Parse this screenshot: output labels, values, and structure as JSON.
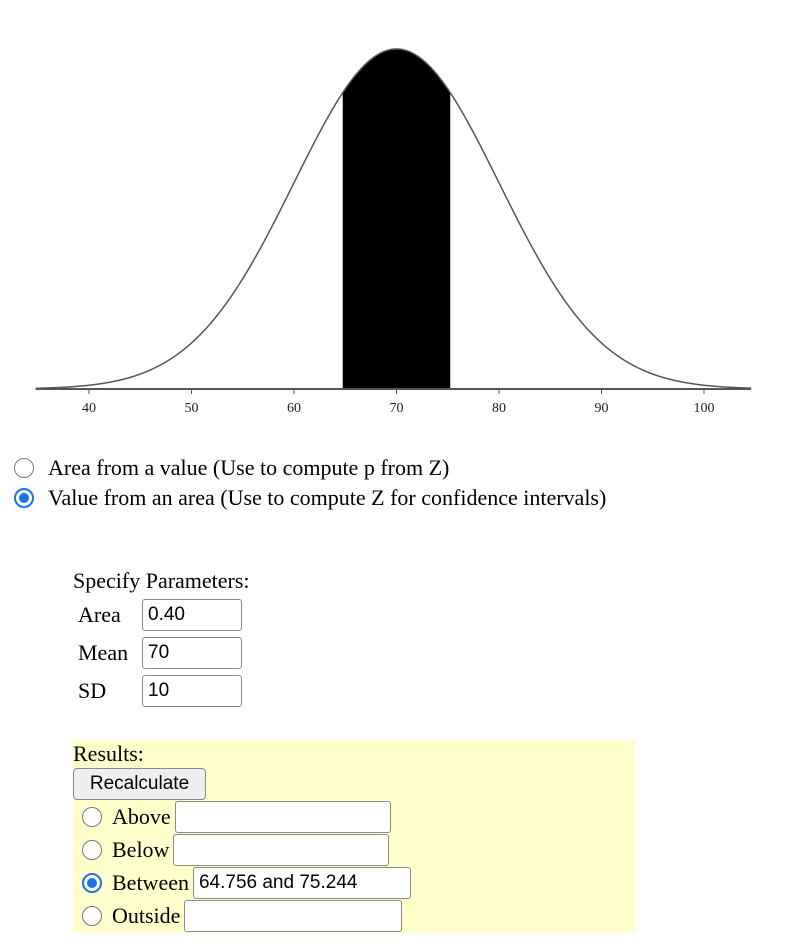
{
  "chart_data": {
    "type": "area",
    "title": "",
    "distribution": "normal",
    "mean": 70,
    "sd": 10,
    "x_range": [
      34.8,
      104.6
    ],
    "x_ticks": [
      40,
      50,
      60,
      70,
      80,
      90,
      100
    ],
    "x_tick_labels": [
      "40",
      "50",
      "60",
      "70",
      "80",
      "90",
      "100"
    ],
    "shaded_region": {
      "type": "between",
      "from": 64.756,
      "to": 75.244,
      "area": 0.4
    },
    "xlabel": "",
    "ylabel": "",
    "grid": false,
    "curve_color": "#555555",
    "shade_color": "#000000"
  },
  "mode_options": [
    {
      "label": "Area from a value (Use to compute p from Z)",
      "checked": false
    },
    {
      "label": "Value from an area (Use to compute Z for confidence intervals)",
      "checked": true
    }
  ],
  "params": {
    "title": "Specify Parameters:",
    "area": {
      "label": "Area",
      "value": "0.40"
    },
    "mean": {
      "label": "Mean",
      "value": "70"
    },
    "sd": {
      "label": "SD",
      "value": "10"
    }
  },
  "results": {
    "title": "Results:",
    "recalculate_label": "Recalculate",
    "background": "#ffffcc",
    "options": [
      {
        "label": "Above",
        "value": "",
        "checked": false
      },
      {
        "label": "Below",
        "value": "",
        "checked": false
      },
      {
        "label": "Between",
        "value": "64.756 and 75.244",
        "checked": true
      },
      {
        "label": "Outside",
        "value": "",
        "checked": false
      }
    ]
  }
}
